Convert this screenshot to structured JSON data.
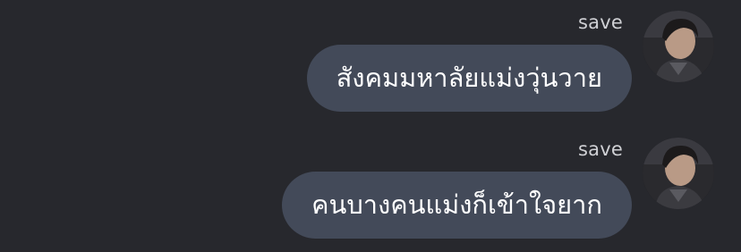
{
  "messages": [
    {
      "sender": "save",
      "text": "สังคมมหาลัยแม่งวุ่นวาย"
    },
    {
      "sender": "save",
      "text": "คนบางคนแม่งก็เข้าใจยาก"
    }
  ],
  "colors": {
    "background": "#27282d",
    "bubble": "#434a59",
    "bubble_text": "#ffffff",
    "sender_text": "#cfd0d4"
  }
}
